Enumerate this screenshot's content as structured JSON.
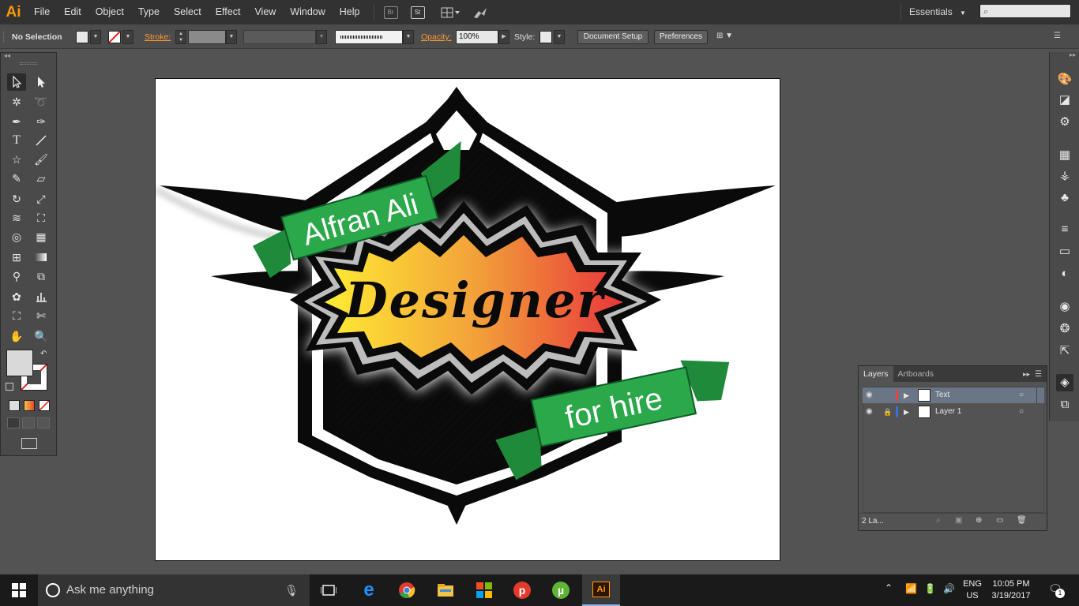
{
  "app": {
    "logo": "Ai"
  },
  "menu": [
    "File",
    "Edit",
    "Object",
    "Type",
    "Select",
    "Effect",
    "View",
    "Window",
    "Help"
  ],
  "menubar_icons": {
    "bridge": "Br",
    "stock": "St"
  },
  "workspace": {
    "label": "Essentials"
  },
  "control": {
    "selection": "No Selection",
    "stroke_label": "Stroke:",
    "opacity_label": "Opacity:",
    "opacity_value": "100%",
    "style_label": "Style:",
    "document_setup": "Document Setup",
    "preferences": "Preferences"
  },
  "artwork": {
    "top_banner": "Alfran Ali",
    "main_word": "Designer",
    "bottom_banner": "for hire",
    "colors": {
      "banner_green": "#2aa84a",
      "gradient_start": "#ffe733",
      "gradient_mid": "#f2a03a",
      "gradient_end": "#e8373b"
    }
  },
  "layers_panel": {
    "tabs": [
      "Layers",
      "Artboards"
    ],
    "layers": [
      {
        "name": "Text",
        "color": "#e0463c",
        "selected": true,
        "locked": false
      },
      {
        "name": "Layer 1",
        "color": "#3b6fd8",
        "selected": false,
        "locked": true
      }
    ],
    "count": "2 La..."
  },
  "taskbar": {
    "search_placeholder": "Ask me anything",
    "lang_top": "ENG",
    "lang_bottom": "US",
    "time": "10:05 PM",
    "date": "3/19/2017",
    "notification_count": "1"
  }
}
